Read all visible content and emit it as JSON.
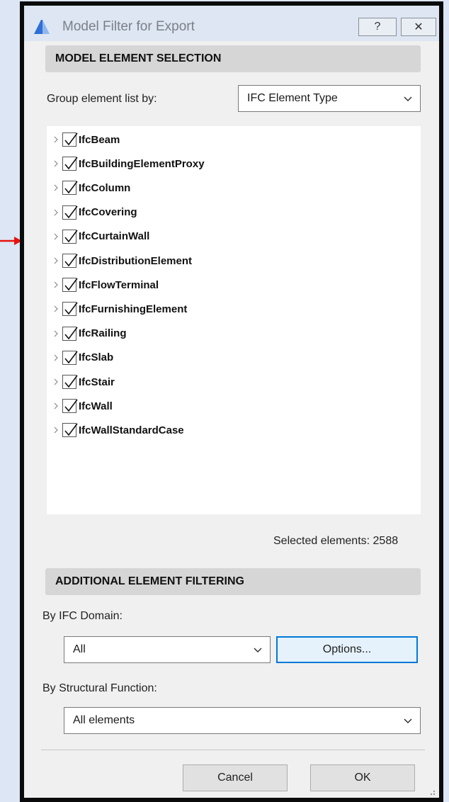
{
  "window": {
    "title": "Model Filter for Export",
    "help_label": "?",
    "close_label": "✕"
  },
  "model_selection": {
    "header": "MODEL ELEMENT SELECTION",
    "group_label": "Group element list by:",
    "group_value": "IFC Element Type",
    "items": [
      {
        "label": "IfcBeam",
        "checked": true
      },
      {
        "label": "IfcBuildingElementProxy",
        "checked": true
      },
      {
        "label": "IfcColumn",
        "checked": true
      },
      {
        "label": "IfcCovering",
        "checked": true
      },
      {
        "label": "IfcCurtainWall",
        "checked": true
      },
      {
        "label": "IfcDistributionElement",
        "checked": true
      },
      {
        "label": "IfcFlowTerminal",
        "checked": true
      },
      {
        "label": "IfcFurnishingElement",
        "checked": true
      },
      {
        "label": "IfcRailing",
        "checked": true
      },
      {
        "label": "IfcSlab",
        "checked": true
      },
      {
        "label": "IfcStair",
        "checked": true
      },
      {
        "label": "IfcWall",
        "checked": true
      },
      {
        "label": "IfcWallStandardCase",
        "checked": true
      }
    ],
    "selected_count_text": "Selected elements: 2588"
  },
  "additional_filtering": {
    "header": "ADDITIONAL ELEMENT FILTERING",
    "domain_label": "By IFC Domain:",
    "domain_value": "All",
    "options_label": "Options...",
    "structural_label": "By Structural Function:",
    "structural_value": "All elements"
  },
  "footer": {
    "cancel_label": "Cancel",
    "ok_label": "OK"
  },
  "colors": {
    "accent": "#0078d7",
    "annotation_arrow": "#e8120c"
  }
}
